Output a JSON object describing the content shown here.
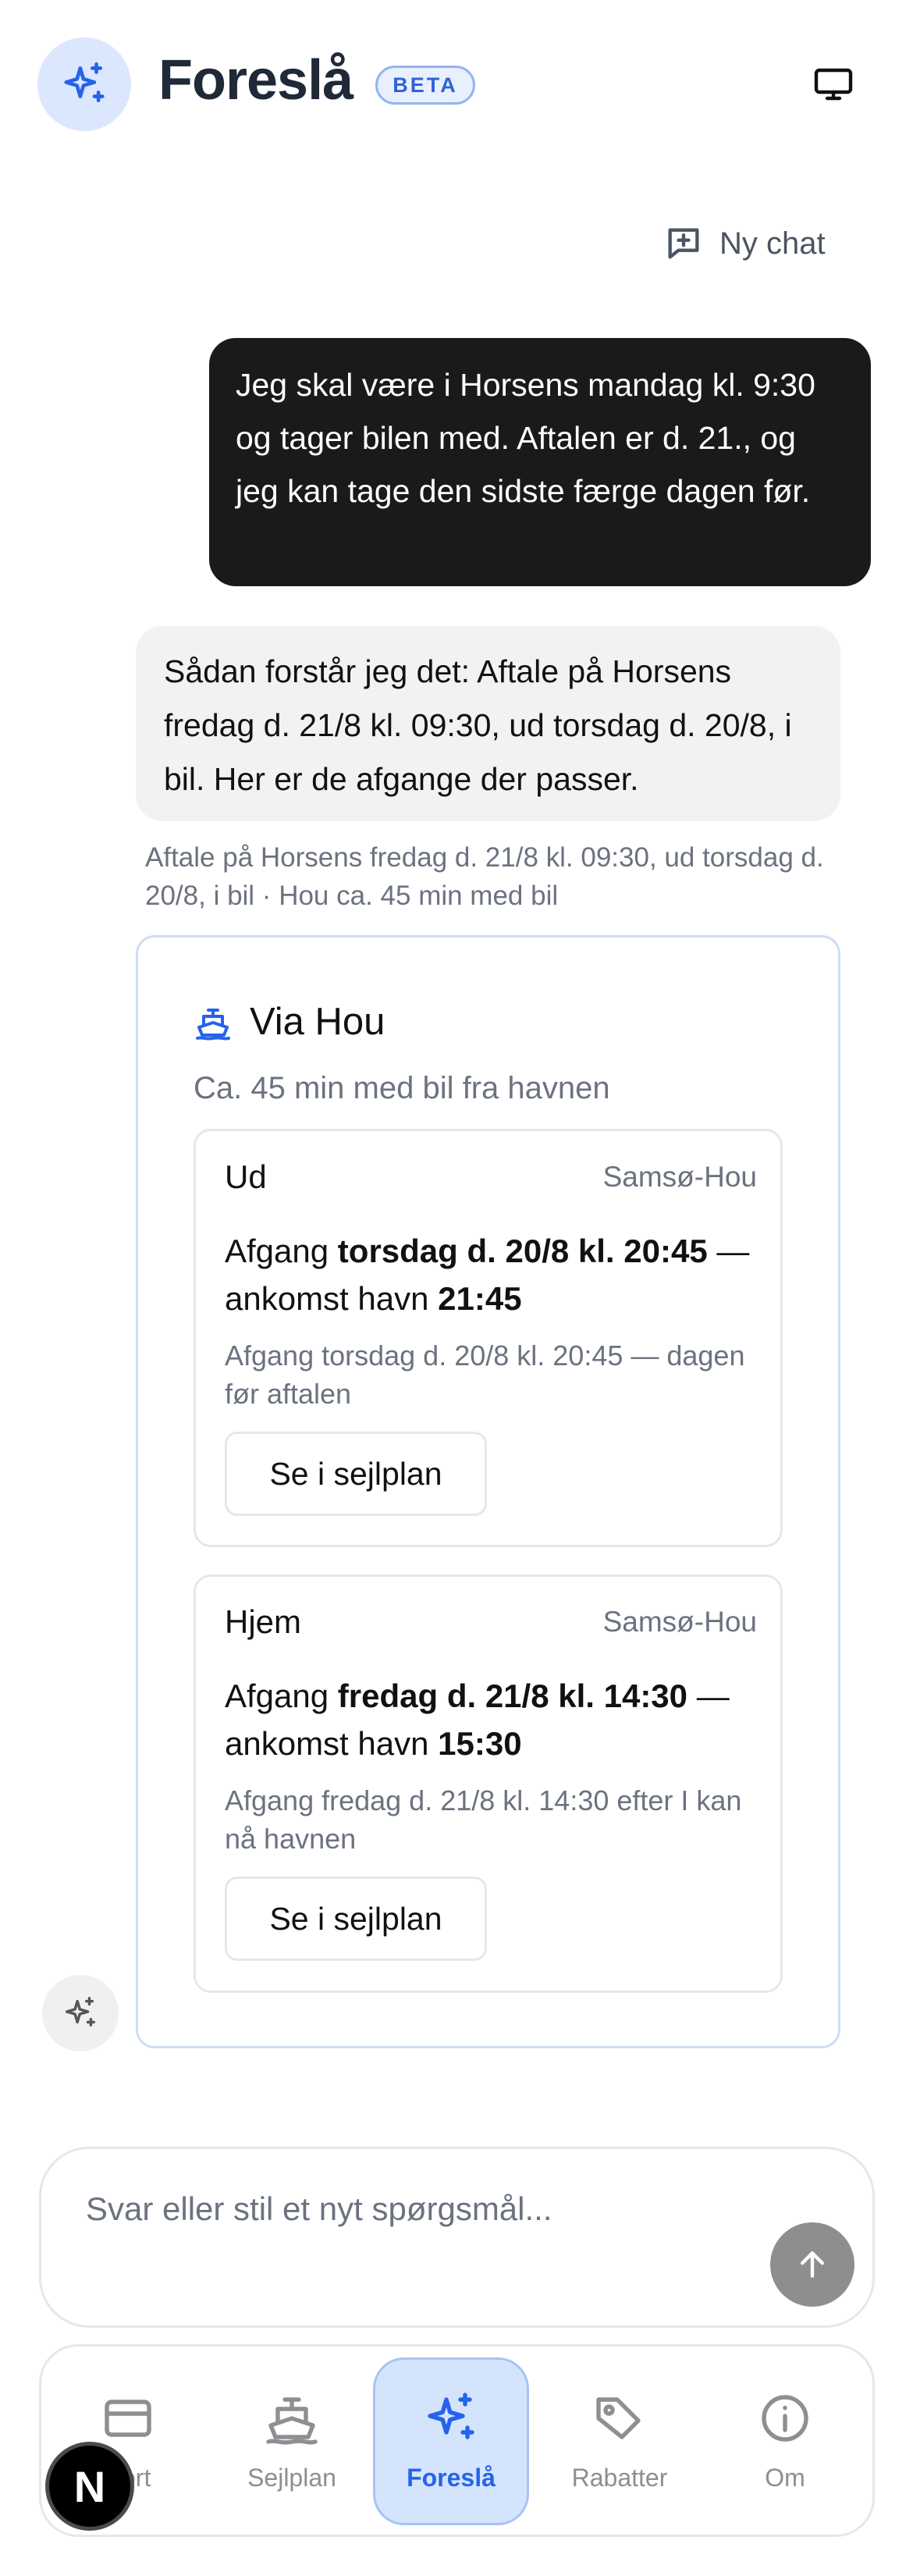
{
  "header": {
    "title": "Foreslå",
    "badge": "BETA",
    "logo_icon": "sparkles-icon",
    "display_icon": "monitor-icon"
  },
  "toolbar": {
    "new_chat_label": "Ny chat",
    "new_chat_icon": "message-plus-icon"
  },
  "conversation": {
    "user_message": "Jeg skal være i Horsens mandag kl. 9:30 og tager bilen med. Aftalen er d. 21., og jeg kan tage den sidste færge dagen før.",
    "assistant_message": "Sådan forstår jeg det: Aftale på Horsens fredag d. 21/8 kl. 09:30, ud torsdag d. 20/8, i bil. Her er de afgange der passer.",
    "summary": "Aftale på Horsens fredag d. 21/8 kl. 09:30, ud torsdag d. 20/8, i bil · Hou ca. 45 min med bil"
  },
  "route_card": {
    "title": "Via Hou",
    "icon": "ferry-icon",
    "subtitle": "Ca. 45 min med bil fra havnen",
    "legs": [
      {
        "direction": "Ud",
        "route": "Samsø-Hou",
        "departure_prefix": "Afgang",
        "departure": "torsdag d. 20/8 kl. 20:45",
        "arrival_prefix": "— ankomst havn",
        "arrival": "21:45",
        "note": "Afgang torsdag d. 20/8 kl. 20:45 — dagen før aftalen",
        "button_label": "Se i sejlplan"
      },
      {
        "direction": "Hjem",
        "route": "Samsø-Hou",
        "departure_prefix": "Afgang",
        "departure": "fredag d. 21/8 kl. 14:30",
        "arrival_prefix": "— ankomst havn",
        "arrival": "15:30",
        "note": "Afgang fredag d. 21/8 kl. 14:30 efter I kan nå havnen",
        "button_label": "Se i sejlplan"
      }
    ]
  },
  "composer": {
    "placeholder": "Svar eller stil et nyt spørgsmål...",
    "send_icon": "arrow-up-icon"
  },
  "bottom_nav": {
    "items": [
      {
        "label": "Kort",
        "icon": "card-icon",
        "active": false
      },
      {
        "label": "Sejlplan",
        "icon": "ferry-icon",
        "active": false
      },
      {
        "label": "Foreslå",
        "icon": "sparkles-icon",
        "active": true
      },
      {
        "label": "Rabatter",
        "icon": "tag-icon",
        "active": false
      },
      {
        "label": "Om",
        "icon": "info-icon",
        "active": false
      }
    ]
  },
  "dev_badge": "N",
  "colors": {
    "accent": "#2563eb",
    "user_bubble": "#1a1a1a",
    "assistant_bubble": "#f2f2f3",
    "send_button": "#8e8e8e"
  }
}
